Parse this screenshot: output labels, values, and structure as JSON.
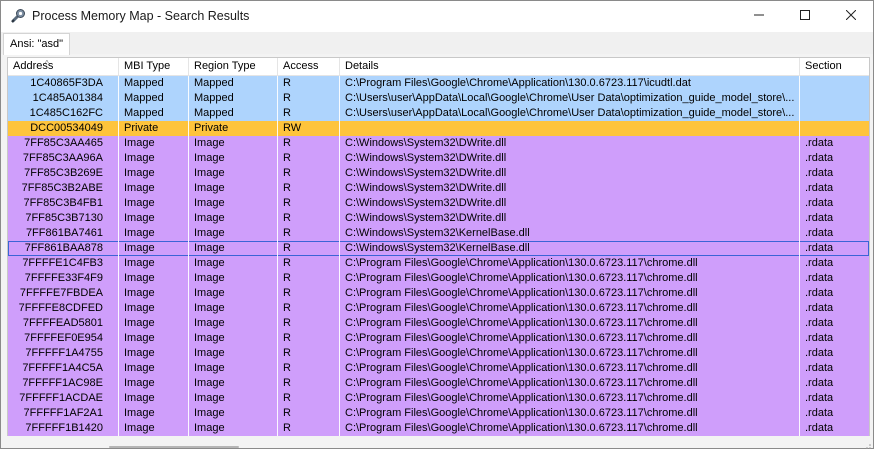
{
  "window": {
    "title": "Process Memory Map - Search Results",
    "icon": "gear-app-icon",
    "controls": [
      "minimize-icon",
      "maximize-icon",
      "close-icon"
    ]
  },
  "tab": {
    "label": "Ansi: \"asd\""
  },
  "columns": [
    "Address",
    "MBI Type",
    "Region Type",
    "Access",
    "Details",
    "Section"
  ],
  "sort": {
    "column": "Address",
    "direction": "ascending"
  },
  "colors": {
    "mapped": "#aed4fd",
    "private": "#fec43c",
    "image": "#cf9efb",
    "selection": "#3b64d6"
  },
  "rows": [
    {
      "kind": "mapped",
      "address": "1C40865F3DA",
      "mbi_type": "Mapped",
      "region_type": "Mapped",
      "access": "R",
      "details": "C:\\Program Files\\Google\\Chrome\\Application\\130.0.6723.117\\icudtl.dat",
      "section": ""
    },
    {
      "kind": "mapped",
      "address": "1C485A01384",
      "mbi_type": "Mapped",
      "region_type": "Mapped",
      "access": "R",
      "details": "C:\\Users\\user\\AppData\\Local\\Google\\Chrome\\User Data\\optimization_guide_model_store\\...",
      "section": ""
    },
    {
      "kind": "mapped",
      "address": "1C485C162FC",
      "mbi_type": "Mapped",
      "region_type": "Mapped",
      "access": "R",
      "details": "C:\\Users\\user\\AppData\\Local\\Google\\Chrome\\User Data\\optimization_guide_model_store\\...",
      "section": ""
    },
    {
      "kind": "private",
      "address": "DCC00534049",
      "mbi_type": "Private",
      "region_type": "Private",
      "access": "RW",
      "details": "",
      "section": ""
    },
    {
      "kind": "image",
      "address": "7FF85C3AA465",
      "mbi_type": "Image",
      "region_type": "Image",
      "access": "R",
      "details": "C:\\Windows\\System32\\DWrite.dll",
      "section": ".rdata"
    },
    {
      "kind": "image",
      "address": "7FF85C3AA96A",
      "mbi_type": "Image",
      "region_type": "Image",
      "access": "R",
      "details": "C:\\Windows\\System32\\DWrite.dll",
      "section": ".rdata"
    },
    {
      "kind": "image",
      "address": "7FF85C3B269E",
      "mbi_type": "Image",
      "region_type": "Image",
      "access": "R",
      "details": "C:\\Windows\\System32\\DWrite.dll",
      "section": ".rdata"
    },
    {
      "kind": "image",
      "address": "7FF85C3B2ABE",
      "mbi_type": "Image",
      "region_type": "Image",
      "access": "R",
      "details": "C:\\Windows\\System32\\DWrite.dll",
      "section": ".rdata"
    },
    {
      "kind": "image",
      "address": "7FF85C3B4FB1",
      "mbi_type": "Image",
      "region_type": "Image",
      "access": "R",
      "details": "C:\\Windows\\System32\\DWrite.dll",
      "section": ".rdata"
    },
    {
      "kind": "image",
      "address": "7FF85C3B7130",
      "mbi_type": "Image",
      "region_type": "Image",
      "access": "R",
      "details": "C:\\Windows\\System32\\DWrite.dll",
      "section": ".rdata"
    },
    {
      "kind": "image",
      "address": "7FF861BA7461",
      "mbi_type": "Image",
      "region_type": "Image",
      "access": "R",
      "details": "C:\\Windows\\System32\\KernelBase.dll",
      "section": ".rdata"
    },
    {
      "kind": "image",
      "selected": true,
      "address": "7FF861BAA878",
      "mbi_type": "Image",
      "region_type": "Image",
      "access": "R",
      "details": "C:\\Windows\\System32\\KernelBase.dll",
      "section": ".rdata"
    },
    {
      "kind": "image",
      "address": "7FFFFE1C4FB3",
      "mbi_type": "Image",
      "region_type": "Image",
      "access": "R",
      "details": "C:\\Program Files\\Google\\Chrome\\Application\\130.0.6723.117\\chrome.dll",
      "section": ".rdata"
    },
    {
      "kind": "image",
      "address": "7FFFFE33F4F9",
      "mbi_type": "Image",
      "region_type": "Image",
      "access": "R",
      "details": "C:\\Program Files\\Google\\Chrome\\Application\\130.0.6723.117\\chrome.dll",
      "section": ".rdata"
    },
    {
      "kind": "image",
      "address": "7FFFFE7FBDEA",
      "mbi_type": "Image",
      "region_type": "Image",
      "access": "R",
      "details": "C:\\Program Files\\Google\\Chrome\\Application\\130.0.6723.117\\chrome.dll",
      "section": ".rdata"
    },
    {
      "kind": "image",
      "address": "7FFFFE8CDFED",
      "mbi_type": "Image",
      "region_type": "Image",
      "access": "R",
      "details": "C:\\Program Files\\Google\\Chrome\\Application\\130.0.6723.117\\chrome.dll",
      "section": ".rdata"
    },
    {
      "kind": "image",
      "address": "7FFFFEAD5801",
      "mbi_type": "Image",
      "region_type": "Image",
      "access": "R",
      "details": "C:\\Program Files\\Google\\Chrome\\Application\\130.0.6723.117\\chrome.dll",
      "section": ".rdata"
    },
    {
      "kind": "image",
      "address": "7FFFFEF0E954",
      "mbi_type": "Image",
      "region_type": "Image",
      "access": "R",
      "details": "C:\\Program Files\\Google\\Chrome\\Application\\130.0.6723.117\\chrome.dll",
      "section": ".rdata"
    },
    {
      "kind": "image",
      "address": "7FFFFF1A4755",
      "mbi_type": "Image",
      "region_type": "Image",
      "access": "R",
      "details": "C:\\Program Files\\Google\\Chrome\\Application\\130.0.6723.117\\chrome.dll",
      "section": ".rdata"
    },
    {
      "kind": "image",
      "address": "7FFFFF1A4C5A",
      "mbi_type": "Image",
      "region_type": "Image",
      "access": "R",
      "details": "C:\\Program Files\\Google\\Chrome\\Application\\130.0.6723.117\\chrome.dll",
      "section": ".rdata"
    },
    {
      "kind": "image",
      "address": "7FFFFF1AC98E",
      "mbi_type": "Image",
      "region_type": "Image",
      "access": "R",
      "details": "C:\\Program Files\\Google\\Chrome\\Application\\130.0.6723.117\\chrome.dll",
      "section": ".rdata"
    },
    {
      "kind": "image",
      "address": "7FFFFF1ACDAE",
      "mbi_type": "Image",
      "region_type": "Image",
      "access": "R",
      "details": "C:\\Program Files\\Google\\Chrome\\Application\\130.0.6723.117\\chrome.dll",
      "section": ".rdata"
    },
    {
      "kind": "image",
      "address": "7FFFFF1AF2A1",
      "mbi_type": "Image",
      "region_type": "Image",
      "access": "R",
      "details": "C:\\Program Files\\Google\\Chrome\\Application\\130.0.6723.117\\chrome.dll",
      "section": ".rdata"
    },
    {
      "kind": "image",
      "address": "7FFFFF1B1420",
      "mbi_type": "Image",
      "region_type": "Image",
      "access": "R",
      "details": "C:\\Program Files\\Google\\Chrome\\Application\\130.0.6723.117\\chrome.dll",
      "section": ".rdata"
    }
  ]
}
